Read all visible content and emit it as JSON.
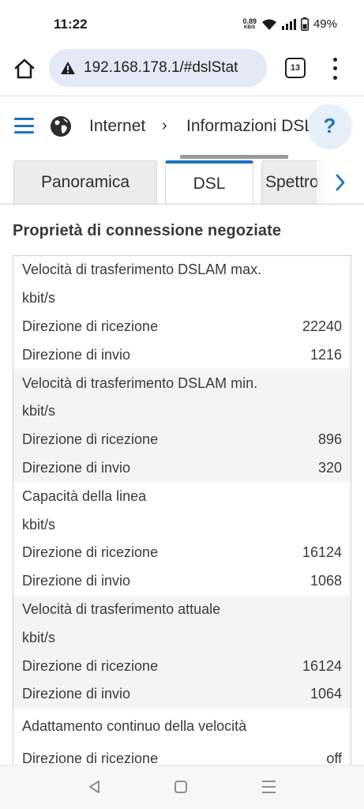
{
  "status_bar": {
    "time": "11:22",
    "net_speed_value": "0.89",
    "net_speed_unit": "KB/S",
    "battery": "49%"
  },
  "browser": {
    "url": "192.168.178.1/#dslStat",
    "tab_count": "13"
  },
  "header": {
    "breadcrumb_1": "Internet",
    "breadcrumb_sep": "›",
    "breadcrumb_2": "Informazioni DSL",
    "help_label": "?"
  },
  "tabs": [
    {
      "label": "Panoramica"
    },
    {
      "label": "DSL"
    },
    {
      "label": "Spettro"
    }
  ],
  "section_title": "Proprietà di connessione negoziate",
  "table": {
    "groups": [
      {
        "title": "Velocità di trasferimento DSLAM max.",
        "unit": "kbit/s",
        "rows": [
          {
            "label": "Direzione di ricezione",
            "value": "22240"
          },
          {
            "label": "Direzione di invio",
            "value": "1216"
          }
        ]
      },
      {
        "title": "Velocità di trasferimento DSLAM min.",
        "unit": "kbit/s",
        "rows": [
          {
            "label": "Direzione di ricezione",
            "value": "896"
          },
          {
            "label": "Direzione di invio",
            "value": "320"
          }
        ]
      },
      {
        "title": "Capacità della linea",
        "unit": "kbit/s",
        "rows": [
          {
            "label": "Direzione di ricezione",
            "value": "16124"
          },
          {
            "label": "Direzione di invio",
            "value": "1068"
          }
        ]
      },
      {
        "title": "Velocità di trasferimento attuale",
        "unit": "kbit/s",
        "rows": [
          {
            "label": "Direzione di ricezione",
            "value": "16124"
          },
          {
            "label": "Direzione di invio",
            "value": "1064"
          }
        ]
      },
      {
        "title": "Adattamento continuo della velocità",
        "rows": [
          {
            "label": "Direzione di ricezione",
            "value": "off"
          }
        ]
      }
    ]
  },
  "colors": {
    "accent": "#1e73be",
    "shade": "#f3f4f3"
  }
}
